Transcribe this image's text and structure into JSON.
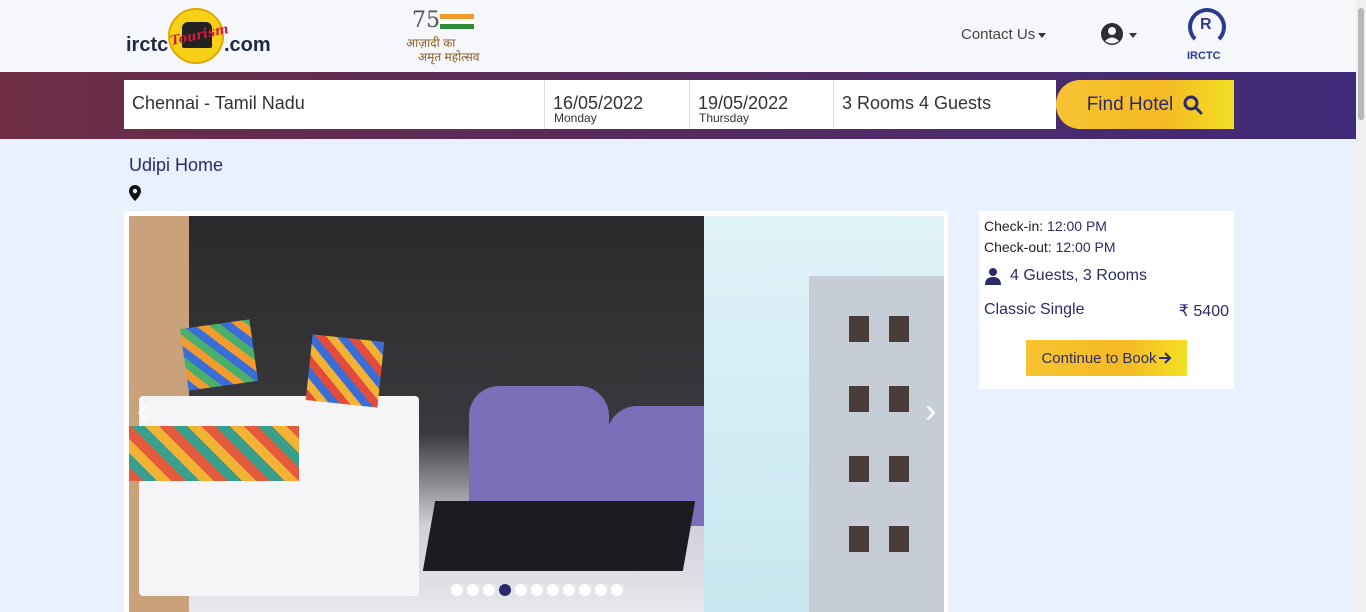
{
  "header": {
    "logo": {
      "left": "irctc",
      "right": ".com",
      "badge": "Tourism"
    },
    "azadi": {
      "number": "75",
      "line1": "आज़ादी का",
      "line2": "अमृत महोत्सव"
    },
    "contact_label": "Contact Us",
    "irctc_label": "IRCTC",
    "irctc_mark": "R"
  },
  "search": {
    "city": "Chennai - Tamil Nadu",
    "checkin_date": "16/05/2022",
    "checkin_day": "Monday",
    "checkout_date": "19/05/2022",
    "checkout_day": "Thursday",
    "guests": "3 Rooms 4 Guests",
    "button_label": "Find Hotel"
  },
  "hotel": {
    "name": "Udipi Home"
  },
  "gallery": {
    "prev_symbol": "‹",
    "next_symbol": "›",
    "slide_count": 11,
    "active_index": 3
  },
  "booking": {
    "checkin_label": "Check-in:",
    "checkin_time": "12:00 PM",
    "checkout_label": "Check-out:",
    "checkout_time": "12:00 PM",
    "guests_rooms": "4 Guests, 3 Rooms",
    "room_type": "Classic Single",
    "price": "₹ 5400",
    "continue_label": "Continue to Book"
  },
  "colors": {
    "primary_text": "#2b2b6b",
    "accent_yellow": "#f5b925",
    "page_bg": "#e8f1fd"
  },
  "icons": {
    "search": "search-icon",
    "user": "user-circle-icon",
    "location": "map-pin-icon",
    "person": "person-icon",
    "arrow": "arrow-right-icon"
  }
}
